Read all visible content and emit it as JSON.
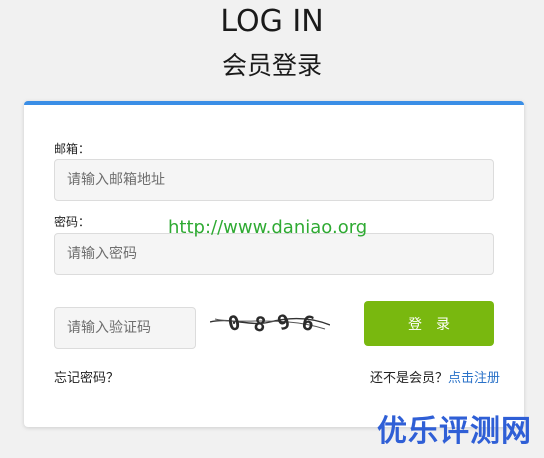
{
  "header": {
    "title_en": "LOG IN",
    "title_cn": "会员登录"
  },
  "form": {
    "email_label": "邮箱：",
    "email_placeholder": "请输入邮箱地址",
    "password_label": "密码：",
    "password_placeholder": "请输入密码",
    "captcha_placeholder": "请输入验证码",
    "captcha_text": "0896",
    "login_button": "登录"
  },
  "footer": {
    "forgot_password": "忘记密码？",
    "not_member": "还不是会员？",
    "register_link": "点击注册"
  },
  "watermarks": {
    "url": "http://www.daniao.org",
    "brand": "优乐评测网"
  },
  "colors": {
    "accent_top_border": "#3a8ee6",
    "login_button": "#79b80f",
    "link": "#2a72c8"
  }
}
